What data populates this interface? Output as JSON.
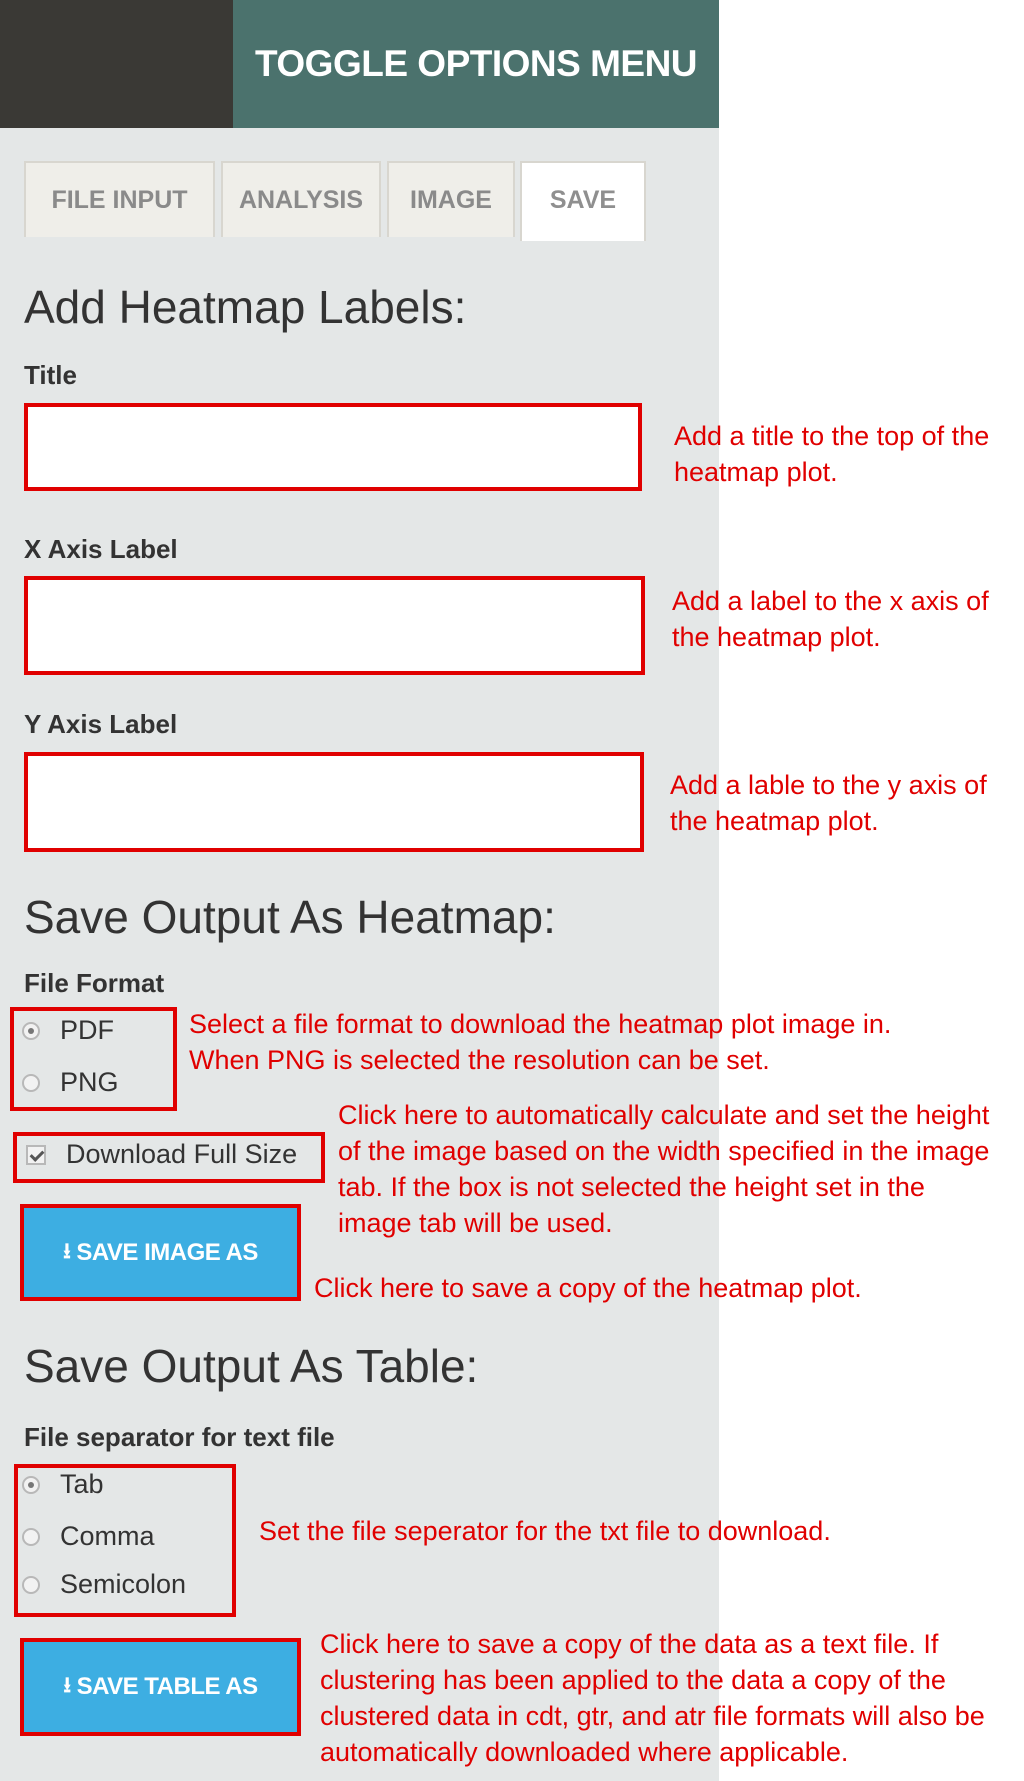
{
  "header": {
    "toggle_label": "TOGGLE OPTIONS MENU"
  },
  "tabs": [
    {
      "label": "FILE INPUT",
      "active": false
    },
    {
      "label": "ANALYSIS",
      "active": false
    },
    {
      "label": "IMAGE",
      "active": false
    },
    {
      "label": "SAVE",
      "active": true
    }
  ],
  "labels_section": {
    "heading": "Add Heatmap Labels:",
    "title_label": "Title",
    "title_value": "",
    "x_label": "X Axis Label",
    "x_value": "",
    "y_label": "Y Axis Label",
    "y_value": ""
  },
  "heatmap_section": {
    "heading": "Save Output As Heatmap:",
    "format_label": "File Format",
    "formats": [
      {
        "label": "PDF",
        "selected": true
      },
      {
        "label": "PNG",
        "selected": false
      }
    ],
    "full_size_label": "Download Full Size",
    "full_size_checked": true,
    "save_button": "SAVE IMAGE AS"
  },
  "table_section": {
    "heading": "Save Output As Table:",
    "separator_label": "File separator for text file",
    "separators": [
      {
        "label": "Tab",
        "selected": true
      },
      {
        "label": "Comma",
        "selected": false
      },
      {
        "label": "Semicolon",
        "selected": false
      }
    ],
    "save_button": "SAVE TABLE AS"
  },
  "annotations": {
    "title_note": [
      "Add a title to the top of the",
      "heatmap plot."
    ],
    "x_note": [
      "Add a label to the x axis of",
      "the heatmap plot."
    ],
    "y_note": [
      "Add a lable to the y axis of",
      "the heatmap plot."
    ],
    "format_note": [
      "Select a file format to download the heatmap plot image in.",
      "When PNG is selected the resolution can be set."
    ],
    "full_size_note": [
      "Click here to automatically calculate and set the height",
      "of the image based on the width specified in the image",
      "tab. If the box is not selected the height set in the",
      "image tab will be used."
    ],
    "save_image_note": [
      "Click here to save a copy of the heatmap plot."
    ],
    "separator_note": [
      "Set the file seperator for the txt file to download."
    ],
    "save_table_note": [
      "Click here to save a copy of the data as a text file. If",
      "clustering has been applied to the data a copy of the",
      "clustered data in cdt, gtr, and atr file formats will also be",
      "automatically downloaded where applicable."
    ]
  },
  "colors": {
    "header_dark": "#3a3935",
    "header_teal": "#4b726d",
    "button_blue": "#3daee2",
    "annotation_red": "#e00000",
    "panel_bg": "#e4e7e7"
  }
}
